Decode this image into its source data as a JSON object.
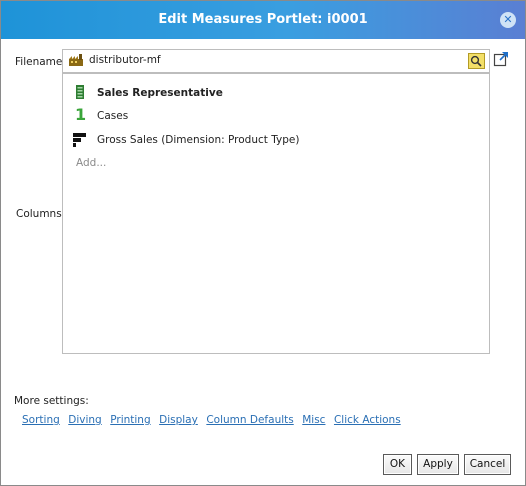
{
  "dialog": {
    "title": "Edit Measures Portlet: i0001",
    "close_icon": "close-icon"
  },
  "filename": {
    "label": "Filename:",
    "value": "distributor-mf",
    "file_icon": "factory-file-icon",
    "browse_icon": "folder-search-icon",
    "open_icon": "open-external-icon"
  },
  "columns": {
    "label": "Columns:",
    "items": [
      {
        "icon": "dimension-column-icon",
        "label": "Sales Representative",
        "bold": true
      },
      {
        "icon": "number-one-icon",
        "label": "Cases",
        "bold": false
      },
      {
        "icon": "bar-chart-icon",
        "label": "Gross Sales (Dimension: Product Type)",
        "bold": false
      }
    ],
    "add_label": "Add..."
  },
  "more_settings": {
    "label": "More settings:",
    "links": [
      "Sorting",
      "Diving",
      "Printing",
      "Display",
      "Column Defaults",
      "Misc",
      "Click Actions"
    ]
  },
  "buttons": {
    "ok": "OK",
    "apply": "Apply",
    "cancel": "Cancel"
  },
  "colors": {
    "title_bar": "#1e93d8",
    "link": "#2a6fb4",
    "cases_icon": "#3aa53a",
    "dimension_icon": "#2e7d32"
  }
}
